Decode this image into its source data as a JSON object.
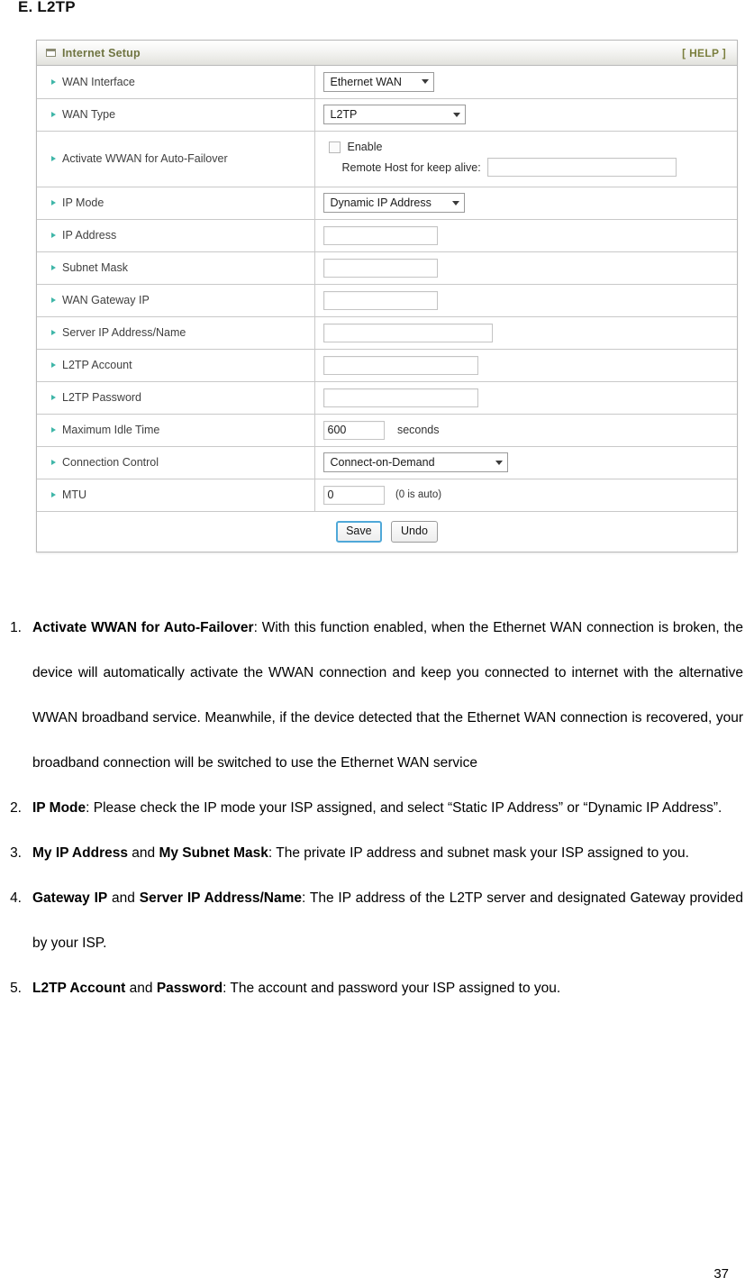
{
  "document": {
    "section_heading": "E. L2TP",
    "page_number": "37"
  },
  "panel": {
    "title": "Internet Setup",
    "title_icon": "window-icon",
    "help_label": "[ HELP ]",
    "accent_color": "#6f7441",
    "bullet_color": "#3fb6a8",
    "rows": [
      {
        "label": "WAN Interface",
        "control": "select",
        "value": "Ethernet WAN"
      },
      {
        "label": "WAN Type",
        "control": "select",
        "value": "L2TP"
      },
      {
        "label": "Activate WWAN for Auto-Failover",
        "control": "checkbox-and-text",
        "checkbox_label": "Enable",
        "checked": false,
        "remote_label": "Remote Host for keep alive:",
        "remote_value": ""
      },
      {
        "label": "IP Mode",
        "control": "select",
        "value": "Dynamic IP Address"
      },
      {
        "label": "IP Address",
        "control": "text",
        "value": ""
      },
      {
        "label": "Subnet Mask",
        "control": "text",
        "value": ""
      },
      {
        "label": "WAN Gateway IP",
        "control": "text",
        "value": ""
      },
      {
        "label": "Server IP Address/Name",
        "control": "text",
        "value": ""
      },
      {
        "label": "L2TP Account",
        "control": "text",
        "value": ""
      },
      {
        "label": "L2TP Password",
        "control": "text",
        "value": ""
      },
      {
        "label": "Maximum Idle Time",
        "control": "text-with-unit",
        "value": "600",
        "unit": "seconds"
      },
      {
        "label": "Connection Control",
        "control": "select",
        "value": "Connect-on-Demand"
      },
      {
        "label": "MTU",
        "control": "text-with-hint",
        "value": "0",
        "hint": "(0 is auto)"
      }
    ],
    "buttons": {
      "save_label": "Save",
      "undo_label": "Undo"
    }
  },
  "descriptions": [
    {
      "number": "1.",
      "term": "Activate WWAN for Auto-Failover",
      "text": ": With this function enabled, when the Ethernet WAN connection is broken, the device will automatically activate the WWAN connection and keep you connected to internet with the alternative WWAN broadband service. Meanwhile, if the device detected that the Ethernet WAN connection is recovered, your broadband connection will be switched to use the Ethernet WAN service"
    },
    {
      "number": "2.",
      "term": "IP Mode",
      "text": ": Please check the IP mode your ISP assigned, and select “Static IP Address” or “Dynamic IP Address”."
    },
    {
      "number": "3.",
      "term": "My IP Address",
      "term2_joiner": " and ",
      "term2": "My Subnet Mask",
      "text": ": The private IP address and subnet mask your ISP assigned to you."
    },
    {
      "number": "4.",
      "term": "Gateway IP",
      "term2_joiner": " and ",
      "term2": "Server IP Address/Name",
      "text": ": The IP address of the L2TP server and designated Gateway provided by your ISP."
    },
    {
      "number": "5.",
      "term": "L2TP Account",
      "term2_joiner": " and ",
      "term2": "Password",
      "text": ": The account and password your ISP assigned to you."
    }
  ]
}
